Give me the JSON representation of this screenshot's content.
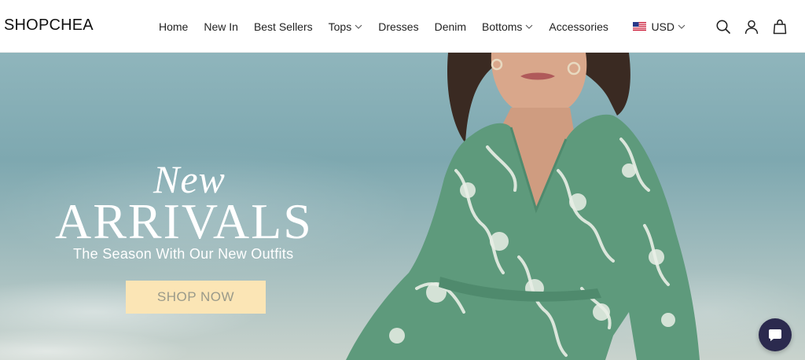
{
  "brand": {
    "logo_text": "SHOPCHEA"
  },
  "nav": {
    "items": [
      {
        "label": "Home",
        "has_dropdown": false
      },
      {
        "label": "New In",
        "has_dropdown": false
      },
      {
        "label": "Best Sellers",
        "has_dropdown": false
      },
      {
        "label": "Tops",
        "has_dropdown": true
      },
      {
        "label": "Dresses",
        "has_dropdown": false
      },
      {
        "label": "Denim",
        "has_dropdown": false
      },
      {
        "label": "Bottoms",
        "has_dropdown": true
      },
      {
        "label": "Accessories",
        "has_dropdown": false
      }
    ]
  },
  "utilities": {
    "currency_label": "USD",
    "currency_flag": "us-flag-icon",
    "icons": [
      "search-icon",
      "account-icon",
      "cart-bag-icon"
    ]
  },
  "hero": {
    "headline_script": "New",
    "headline_main": "ARRIVALS",
    "tagline": "The Season With Our New Outfits",
    "cta_label": "SHOP NOW"
  },
  "chat": {
    "icon": "chat-bubble-icon"
  },
  "colors": {
    "cta_bg": "#fbe5b5",
    "chat_bg": "#2b2a4e",
    "dress_green": "#5e9a7c"
  }
}
